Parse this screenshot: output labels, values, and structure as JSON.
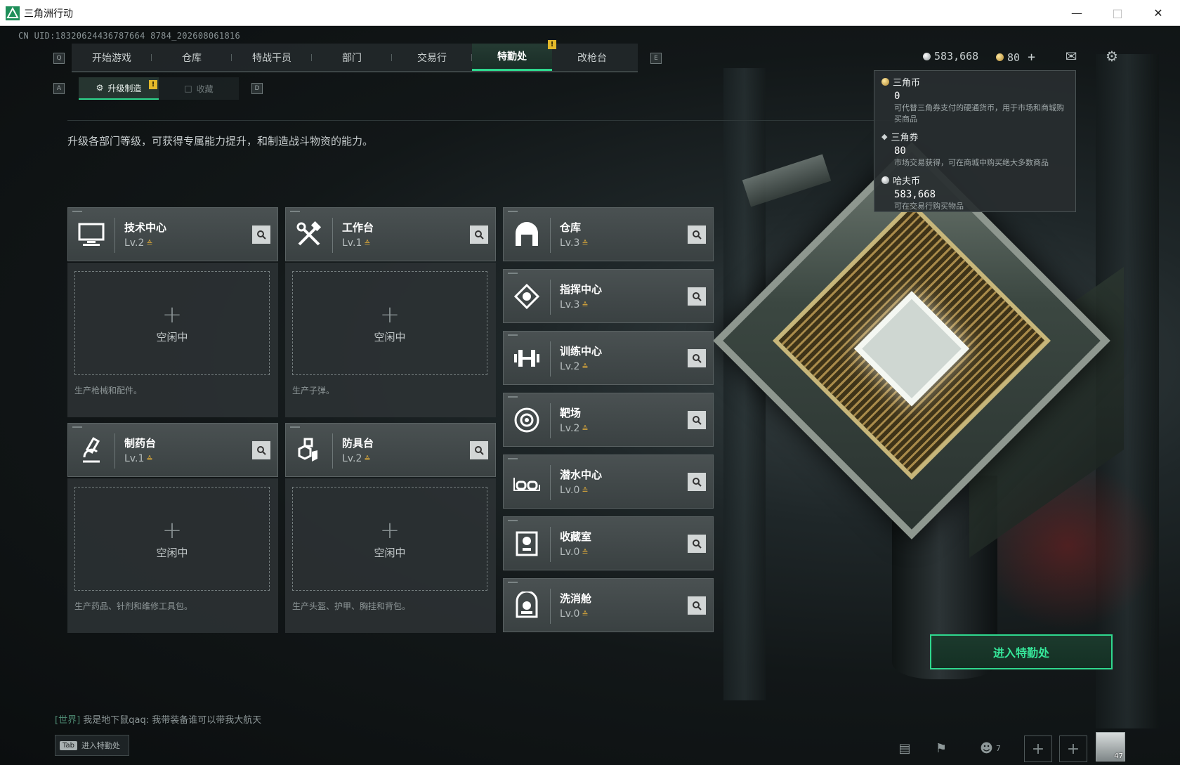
{
  "window": {
    "title": "三角洲行动"
  },
  "uid": "CN UID:18320624436787664 8784_202608061816",
  "nav": {
    "key_left": "Q",
    "key_right": "E",
    "tabs": [
      {
        "label": "开始游戏",
        "active": false
      },
      {
        "label": "仓库",
        "active": false
      },
      {
        "label": "特战干员",
        "active": false
      },
      {
        "label": "部门",
        "active": false
      },
      {
        "label": "交易行",
        "active": false
      },
      {
        "label": "特勤处",
        "active": true
      },
      {
        "label": "改枪台",
        "active": false
      }
    ],
    "badge": "!"
  },
  "subnav": {
    "key_left": "A",
    "key_right": "D",
    "tabs": [
      {
        "label": "升级制造",
        "active": true
      },
      {
        "label": "收藏",
        "active": false
      }
    ],
    "badge": "!"
  },
  "description": "升级各部门等级，可获得专属能力提升，和制造战斗物资的能力。",
  "currency": {
    "hafu": "583,668",
    "triangle_coin": "80",
    "add": "+"
  },
  "tooltip": [
    {
      "name": "三角币",
      "value": "0",
      "desc": "可代替三角券支付的硬通货币，用于市场和商城购买商品"
    },
    {
      "name": "三角券",
      "value": "80",
      "desc": "市场交易获得，可在商城中购买绝大多数商品"
    },
    {
      "name": "哈夫币",
      "value": "583,668",
      "desc": "可在交易行购买物品"
    }
  ],
  "production_cards": [
    {
      "name": "技术中心",
      "level": "Lv.2",
      "idle": "空闲中",
      "desc": "生产枪械和配件。",
      "icon": "monitor-icon"
    },
    {
      "name": "工作台",
      "level": "Lv.1",
      "idle": "空闲中",
      "desc": "生产子弹。",
      "icon": "tools-icon"
    },
    {
      "name": "制药台",
      "level": "Lv.1",
      "idle": "空闲中",
      "desc": "生产药品、针剂和维修工具包。",
      "icon": "microscope-icon"
    },
    {
      "name": "防具台",
      "level": "Lv.2",
      "idle": "空闲中",
      "desc": "生产头盔、护甲、胸挂和背包。",
      "icon": "armor-icon"
    }
  ],
  "facilities": [
    {
      "name": "仓库",
      "level": "Lv.3",
      "icon": "warehouse-icon"
    },
    {
      "name": "指挥中心",
      "level": "Lv.3",
      "icon": "command-icon"
    },
    {
      "name": "训练中心",
      "level": "Lv.2",
      "icon": "dumbbell-icon"
    },
    {
      "name": "靶场",
      "level": "Lv.2",
      "icon": "target-icon"
    },
    {
      "name": "潜水中心",
      "level": "Lv.0",
      "icon": "diving-mask-icon"
    },
    {
      "name": "收藏室",
      "level": "Lv.0",
      "icon": "collection-icon"
    },
    {
      "name": "洗消舱",
      "level": "Lv.0",
      "icon": "hazmat-icon"
    }
  ],
  "enter_button": "进入特勤处",
  "chat": {
    "channel": "[世界]",
    "message": "我是地下鼠qaq: 我带装备谁可以带我大航天"
  },
  "tab_hint": {
    "key": "Tab",
    "label": "进入特勤处"
  },
  "bottom": {
    "friends": "7",
    "level": "47"
  },
  "colors": {
    "accent": "#2fd88e",
    "gold": "#d7a63a"
  }
}
